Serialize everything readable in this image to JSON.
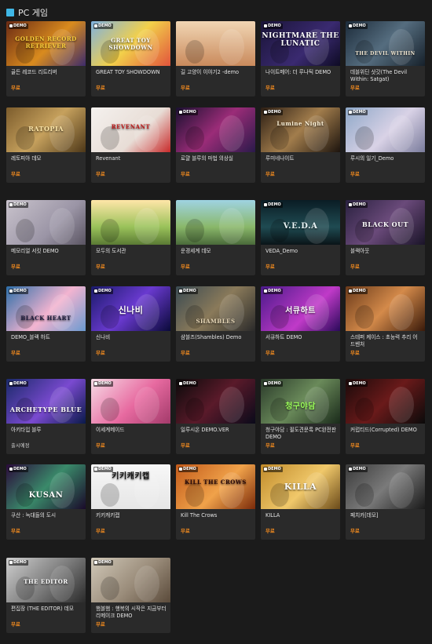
{
  "section": {
    "title": "PC 게임",
    "icon": "pc-icon"
  },
  "colors": {
    "background": "#1b1b1b",
    "card": "#2a2a2a",
    "price": "#f08a1f"
  },
  "games": [
    {
      "title": "골든 레코드 리트리버",
      "price": "무료",
      "badge": "DEMO",
      "art": "GOLDEN RECORD RETRIEVER"
    },
    {
      "title": "GREAT TOY SHOWDOWN",
      "price": "무료",
      "badge": "DEMO",
      "art": "GREAT TOY SHOWDOWN"
    },
    {
      "title": "길 고양이 이야기2 -demo",
      "price": "무료",
      "badge": "",
      "art": ""
    },
    {
      "title": "나이트메어: 더 루나틱 DEMO",
      "price": "무료",
      "badge": "DEMO",
      "art": "NIGHTMARE THE LUNATIC"
    },
    {
      "title": "데블위딘 샷갓(The Devil Within: Satgat)",
      "price": "무료",
      "badge": "DEMO",
      "art": "THE DEVIL WITHIN"
    },
    {
      "title": "레토피아 데모",
      "price": "무료",
      "badge": "",
      "art": "RATOPIA"
    },
    {
      "title": "Revenant",
      "price": "무료",
      "badge": "",
      "art": "REVENANT"
    },
    {
      "title": "로얄 블루의 마법 의상실",
      "price": "무료",
      "badge": "DEMO",
      "art": ""
    },
    {
      "title": "루미네나이트",
      "price": "무료",
      "badge": "DEMO",
      "art": "Lumine Night"
    },
    {
      "title": "루시의 일기_Demo",
      "price": "무료",
      "badge": "DEMO",
      "art": ""
    },
    {
      "title": "메모리얼 서킷 DEMO",
      "price": "무료",
      "badge": "DEMO",
      "art": ""
    },
    {
      "title": "모두의 도서관",
      "price": "무료",
      "badge": "",
      "art": ""
    },
    {
      "title": "운경세계 데모",
      "price": "무료",
      "badge": "",
      "art": ""
    },
    {
      "title": "VEDA_Demo",
      "price": "무료",
      "badge": "DEMO",
      "art": "V.E.D.A"
    },
    {
      "title": "블랙아웃",
      "price": "무료",
      "badge": "DEMO",
      "art": "BLACK OUT"
    },
    {
      "title": "DEMO_블랙 하트",
      "price": "무료",
      "badge": "DEMO",
      "art": "BLACK HEART"
    },
    {
      "title": "신나비",
      "price": "무료",
      "badge": "DEMO",
      "art": "신나비"
    },
    {
      "title": "샴블즈(Shambles) Demo",
      "price": "무료",
      "badge": "DEMO",
      "art": "SHAMBLES"
    },
    {
      "title": "서큐하트 DEMO",
      "price": "무료",
      "badge": "DEMO",
      "art": "서큐하트"
    },
    {
      "title": "스테퍼 케이스 : 초능력 추리 어드벤처",
      "price": "무료",
      "badge": "DEMO",
      "art": ""
    },
    {
      "title": "아키타입 블루",
      "price": "출시예정",
      "badge": "DEMO",
      "art": "ARCHETYPE BLUE"
    },
    {
      "title": "이세계메이드",
      "price": "무료",
      "badge": "DEMO",
      "art": ""
    },
    {
      "title": "일루시온 DEMO.VER",
      "price": "무료",
      "badge": "DEMO",
      "art": ""
    },
    {
      "title": "청구야담 : 필도견문록 PC완전판 DEMO",
      "price": "무료",
      "badge": "DEMO",
      "art": "청구야담"
    },
    {
      "title": "커럽티드(Corrupted) DEMO",
      "price": "무료",
      "badge": "DEMO",
      "art": ""
    },
    {
      "title": "쿠산 : 늑대들의 도시",
      "price": "무료",
      "badge": "DEMO",
      "art": "KUSAN"
    },
    {
      "title": "키키캐키캡",
      "price": "무료",
      "badge": "DEMO",
      "art": "키키캐키캡"
    },
    {
      "title": "Kill The Crows",
      "price": "무료",
      "badge": "DEMO",
      "art": "KILL THE CROWS"
    },
    {
      "title": "KILLA",
      "price": "무료",
      "badge": "DEMO",
      "art": "KILLA"
    },
    {
      "title": "페치카[데모]",
      "price": "무료",
      "badge": "DEMO",
      "art": ""
    },
    {
      "title": "편집장 (THE EDITOR) 데모",
      "price": "무료",
      "badge": "DEMO",
      "art": "THE EDITOR"
    },
    {
      "title": "햄볼햄 : 행복의 시작은 지금부터 리메이크 DEMO",
      "price": "무료",
      "badge": "DEMO",
      "art": ""
    }
  ]
}
